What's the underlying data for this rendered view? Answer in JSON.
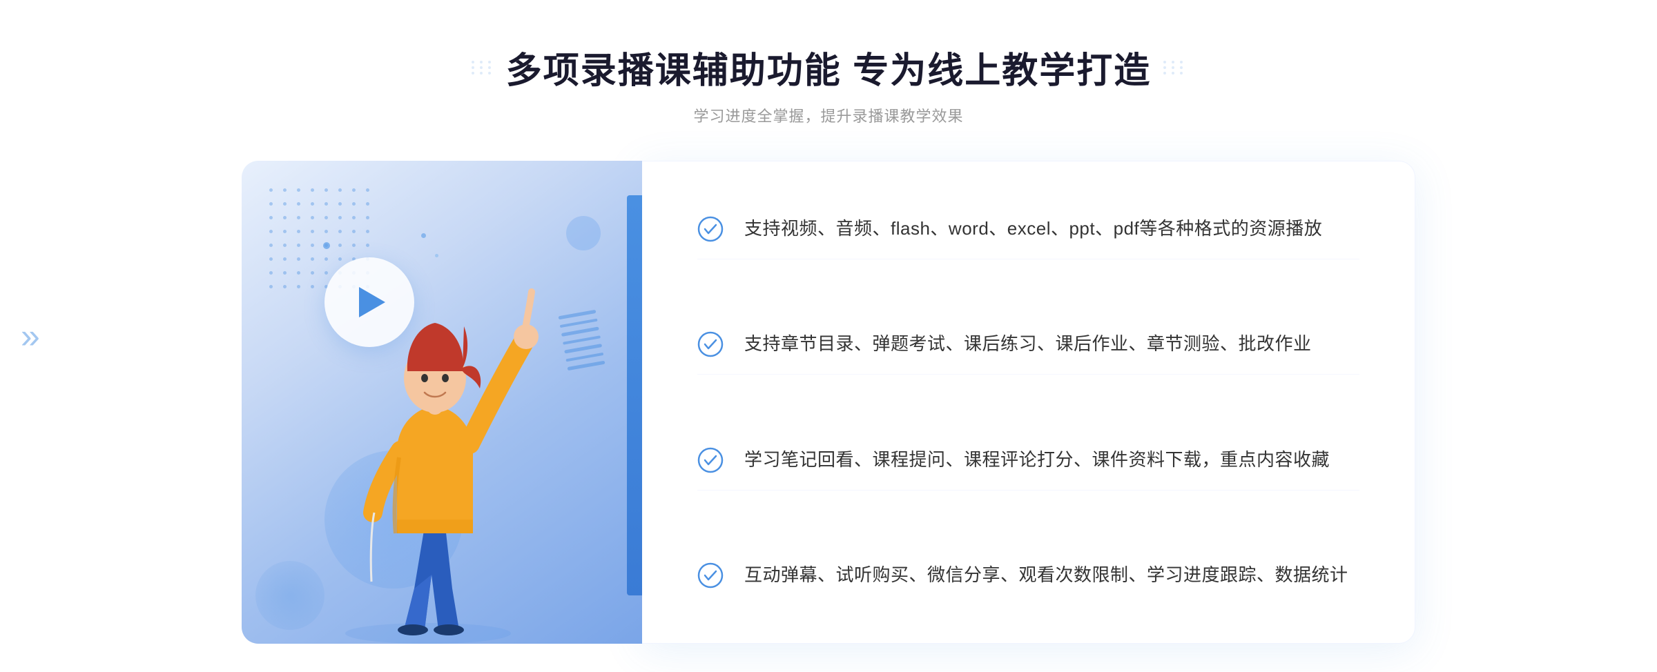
{
  "header": {
    "title": "多项录播课辅助功能 专为线上教学打造",
    "subtitle": "学习进度全掌握，提升录播课教学效果",
    "title_deco_left": "⁝⁝",
    "title_deco_right": "⁝⁝"
  },
  "features": [
    {
      "id": 1,
      "text": "支持视频、音频、flash、word、excel、ppt、pdf等各种格式的资源播放"
    },
    {
      "id": 2,
      "text": "支持章节目录、弹题考试、课后练习、课后作业、章节测验、批改作业"
    },
    {
      "id": 3,
      "text": "学习笔记回看、课程提问、课程评论打分、课件资料下载，重点内容收藏"
    },
    {
      "id": 4,
      "text": "互动弹幕、试听购买、微信分享、观看次数限制、学习进度跟踪、数据统计"
    }
  ],
  "colors": {
    "accent_blue": "#4a90e2",
    "title_color": "#1a1a2e",
    "text_color": "#333333",
    "subtitle_color": "#999999",
    "bg_white": "#ffffff"
  },
  "side_chevron": "»",
  "check_mark": "✓"
}
